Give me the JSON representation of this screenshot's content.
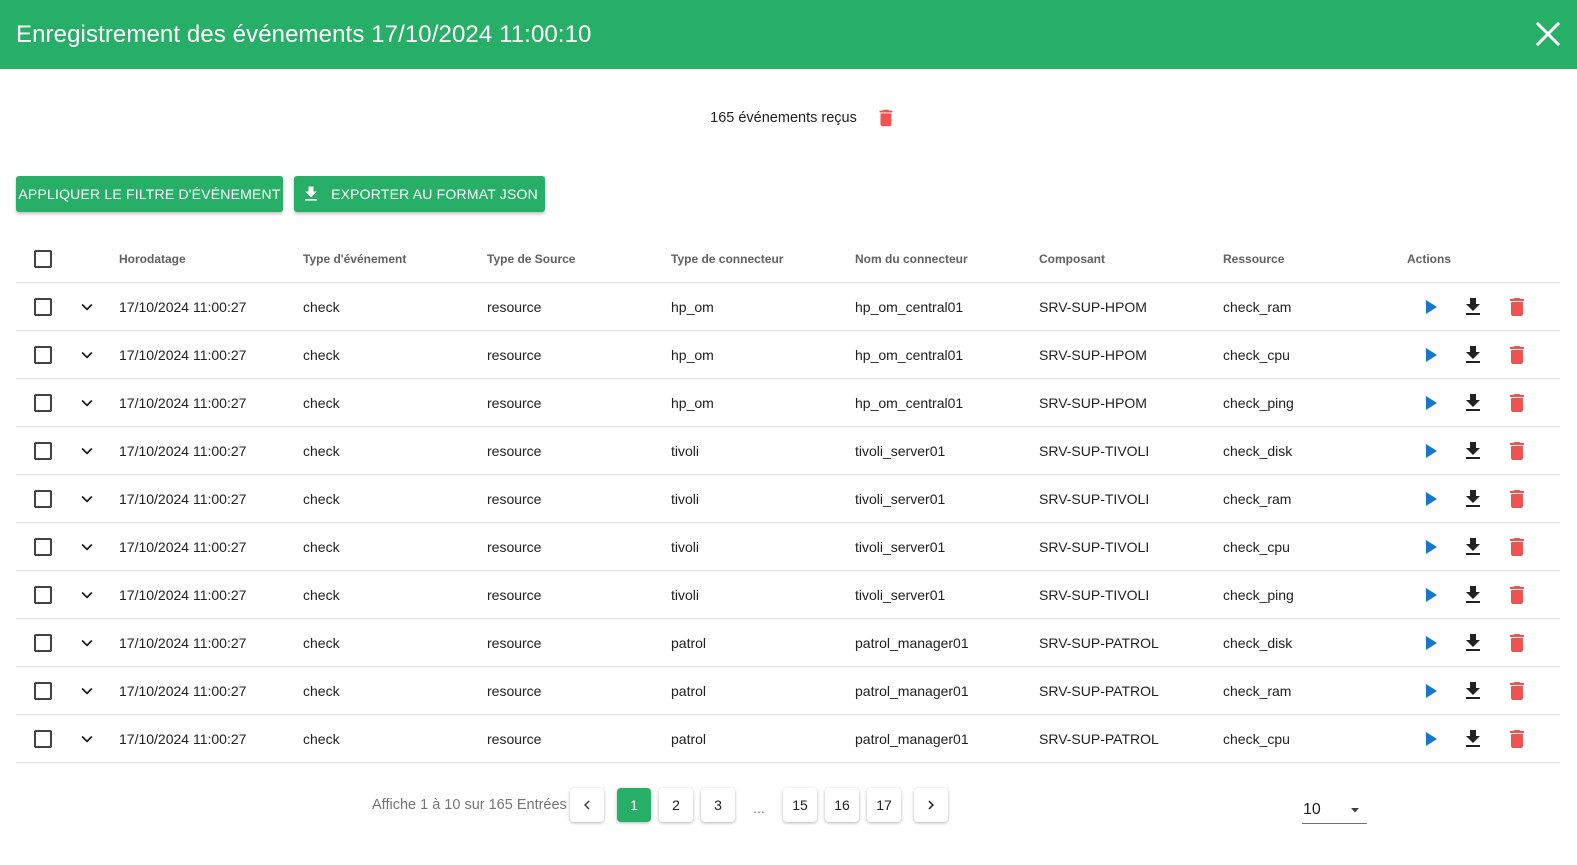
{
  "dialog": {
    "title": "Enregistrement des événements 17/10/2024 11:00:10",
    "close_icon": "close-icon"
  },
  "summary": {
    "text": "165 événements reçus",
    "delete_icon": "trash-icon"
  },
  "toolbar": {
    "filter_label": "Appliquer le filtre d'événement",
    "export_label": "Exporter au format JSON",
    "export_icon": "download-icon"
  },
  "table": {
    "headers": {
      "timestamp": "Horodatage",
      "event_type": "Type d'événement",
      "source_type": "Type de Source",
      "connector_type": "Type de connecteur",
      "connector_name": "Nom du connecteur",
      "component": "Composant",
      "resource": "Ressource",
      "actions": "Actions"
    },
    "rows": [
      {
        "timestamp": "17/10/2024 11:00:27",
        "event_type": "check",
        "source_type": "resource",
        "connector_type": "hp_om",
        "connector_name": "hp_om_central01",
        "component": "SRV-SUP-HPOM",
        "resource": "check_ram"
      },
      {
        "timestamp": "17/10/2024 11:00:27",
        "event_type": "check",
        "source_type": "resource",
        "connector_type": "hp_om",
        "connector_name": "hp_om_central01",
        "component": "SRV-SUP-HPOM",
        "resource": "check_cpu"
      },
      {
        "timestamp": "17/10/2024 11:00:27",
        "event_type": "check",
        "source_type": "resource",
        "connector_type": "hp_om",
        "connector_name": "hp_om_central01",
        "component": "SRV-SUP-HPOM",
        "resource": "check_ping"
      },
      {
        "timestamp": "17/10/2024 11:00:27",
        "event_type": "check",
        "source_type": "resource",
        "connector_type": "tivoli",
        "connector_name": "tivoli_server01",
        "component": "SRV-SUP-TIVOLI",
        "resource": "check_disk"
      },
      {
        "timestamp": "17/10/2024 11:00:27",
        "event_type": "check",
        "source_type": "resource",
        "connector_type": "tivoli",
        "connector_name": "tivoli_server01",
        "component": "SRV-SUP-TIVOLI",
        "resource": "check_ram"
      },
      {
        "timestamp": "17/10/2024 11:00:27",
        "event_type": "check",
        "source_type": "resource",
        "connector_type": "tivoli",
        "connector_name": "tivoli_server01",
        "component": "SRV-SUP-TIVOLI",
        "resource": "check_cpu"
      },
      {
        "timestamp": "17/10/2024 11:00:27",
        "event_type": "check",
        "source_type": "resource",
        "connector_type": "tivoli",
        "connector_name": "tivoli_server01",
        "component": "SRV-SUP-TIVOLI",
        "resource": "check_ping"
      },
      {
        "timestamp": "17/10/2024 11:00:27",
        "event_type": "check",
        "source_type": "resource",
        "connector_type": "patrol",
        "connector_name": "patrol_manager01",
        "component": "SRV-SUP-PATROL",
        "resource": "check_disk"
      },
      {
        "timestamp": "17/10/2024 11:00:27",
        "event_type": "check",
        "source_type": "resource",
        "connector_type": "patrol",
        "connector_name": "patrol_manager01",
        "component": "SRV-SUP-PATROL",
        "resource": "check_ram"
      },
      {
        "timestamp": "17/10/2024 11:00:27",
        "event_type": "check",
        "source_type": "resource",
        "connector_type": "patrol",
        "connector_name": "patrol_manager01",
        "component": "SRV-SUP-PATROL",
        "resource": "check_cpu"
      }
    ],
    "row_action_icons": [
      "play-icon",
      "download-icon",
      "trash-icon"
    ]
  },
  "pagination": {
    "info": "Affiche 1 à 10 sur 165 Entrées",
    "pages": [
      "1",
      "2",
      "3",
      "15",
      "16",
      "17"
    ],
    "ellipsis": "...",
    "current_page": "1",
    "per_page": "10"
  },
  "colors": {
    "brand_green": "#27ae67",
    "play_blue": "#1976d2",
    "delete_red": "#ef5350",
    "icon_dark": "#212121"
  }
}
